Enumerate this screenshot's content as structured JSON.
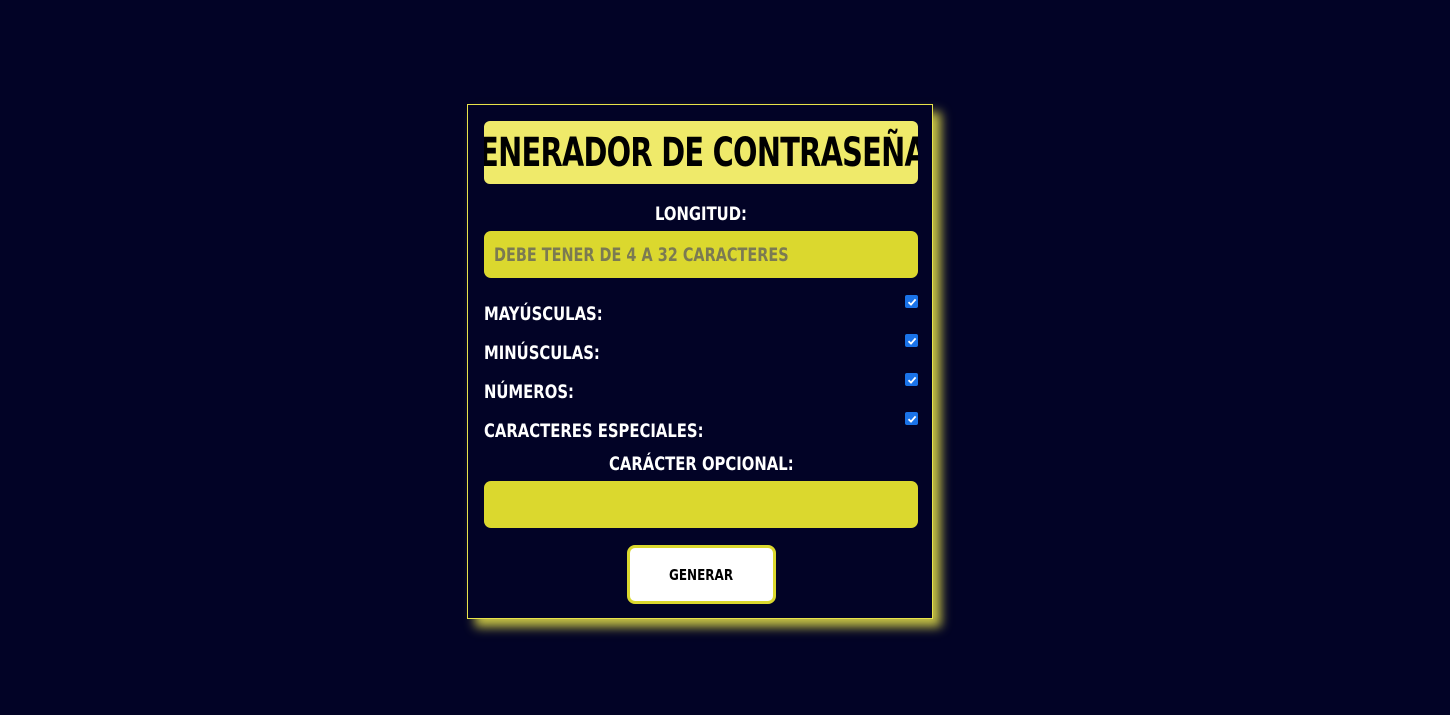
{
  "header": {
    "title": "GENERADOR DE CONTRASEÑAS"
  },
  "length": {
    "label": "LONGITUD:",
    "placeholder": "DEBE TENER DE 4 A 32 CARACTERES",
    "value": ""
  },
  "options": [
    {
      "label": "MAYÚSCULAS:",
      "checked": true
    },
    {
      "label": "MINÚSCULAS:",
      "checked": true
    },
    {
      "label": "NÚMEROS:",
      "checked": true
    },
    {
      "label": "CARACTERES ESPECIALES:",
      "checked": true
    }
  ],
  "optional_char": {
    "label": "CARÁCTER OPCIONAL:",
    "value": ""
  },
  "generate_button": {
    "label": "GENERAR"
  },
  "colors": {
    "background": "#020326",
    "accent": "#dbd82e",
    "title_bg": "#efea6a",
    "checkbox": "#1a73e8"
  }
}
